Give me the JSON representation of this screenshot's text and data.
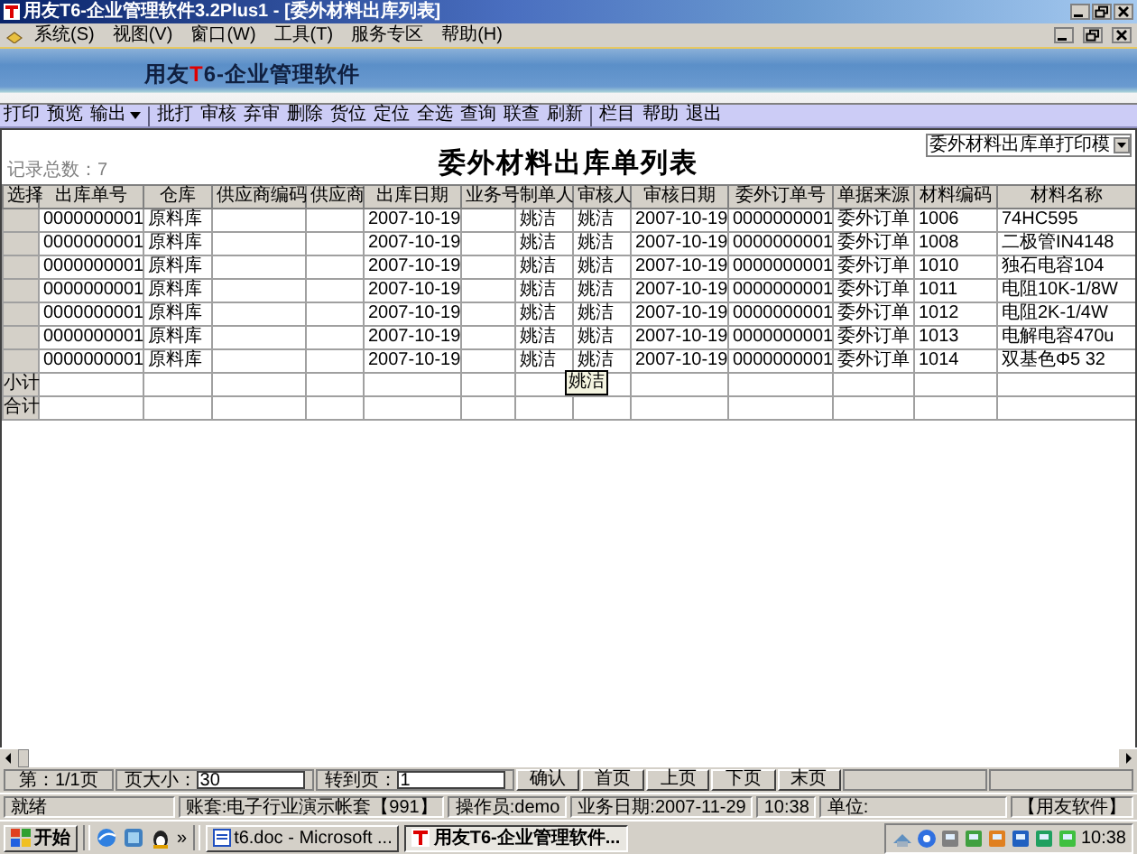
{
  "window": {
    "title": "用友T6-企业管理软件3.2Plus1 - [委外材料出库列表]"
  },
  "menu": [
    "系统(S)",
    "视图(V)",
    "窗口(W)",
    "工具(T)",
    "服务专区",
    "帮助(H)"
  ],
  "banner": {
    "prefix": "用友",
    "accent": "T",
    "suffix": "6-企业管理软件"
  },
  "toolbar": [
    [
      {
        "label": "打印",
        "kind": "button"
      },
      {
        "label": "预览",
        "kind": "button"
      },
      {
        "label": "输出",
        "kind": "dropdown"
      }
    ],
    [
      {
        "label": "批打",
        "kind": "button"
      },
      {
        "label": "审核",
        "kind": "button"
      },
      {
        "label": "弃审",
        "kind": "button"
      },
      {
        "label": "删除",
        "kind": "button"
      },
      {
        "label": "货位",
        "kind": "button"
      },
      {
        "label": "定位",
        "kind": "button"
      },
      {
        "label": "全选",
        "kind": "button"
      },
      {
        "label": "查询",
        "kind": "button"
      },
      {
        "label": "联查",
        "kind": "button"
      },
      {
        "label": "刷新",
        "kind": "button"
      }
    ],
    [
      {
        "label": "栏目",
        "kind": "button"
      },
      {
        "label": "帮助",
        "kind": "button"
      },
      {
        "label": "退出",
        "kind": "button"
      }
    ]
  ],
  "report": {
    "title": "委外材料出库单列表",
    "record_count": "记录总数：7",
    "template": "委外材料出库单打印模"
  },
  "table": {
    "columns": [
      "选择",
      "出库单号",
      "仓库",
      "供应商编码",
      "供应商",
      "出库日期",
      "业务号",
      "制单人",
      "审核人",
      "审核日期",
      "委外订单号",
      "单据来源",
      "材料编码",
      "材料名称"
    ],
    "rows": [
      {
        "cells": [
          "",
          "0000000001",
          "原料库",
          "",
          "",
          "2007-10-19",
          "",
          "姚洁",
          "姚洁",
          "2007-10-19",
          "0000000001",
          "委外订单",
          "1006",
          "74HC595"
        ]
      },
      {
        "cells": [
          "",
          "0000000001",
          "原料库",
          "",
          "",
          "2007-10-19",
          "",
          "姚洁",
          "姚洁",
          "2007-10-19",
          "0000000001",
          "委外订单",
          "1008",
          "二极管IN4148"
        ]
      },
      {
        "cells": [
          "",
          "0000000001",
          "原料库",
          "",
          "",
          "2007-10-19",
          "",
          "姚洁",
          "姚洁",
          "2007-10-19",
          "0000000001",
          "委外订单",
          "1010",
          "独石电容104"
        ]
      },
      {
        "cells": [
          "",
          "0000000001",
          "原料库",
          "",
          "",
          "2007-10-19",
          "",
          "姚洁",
          "姚洁",
          "2007-10-19",
          "0000000001",
          "委外订单",
          "1011",
          "电阻10K-1/8W"
        ]
      },
      {
        "cells": [
          "",
          "0000000001",
          "原料库",
          "",
          "",
          "2007-10-19",
          "",
          "姚洁",
          "姚洁",
          "2007-10-19",
          "0000000001",
          "委外订单",
          "1012",
          "电阻2K-1/4W"
        ]
      },
      {
        "cells": [
          "",
          "0000000001",
          "原料库",
          "",
          "",
          "2007-10-19",
          "",
          "姚洁",
          "姚洁",
          "2007-10-19",
          "0000000001",
          "委外订单",
          "1013",
          "电解电容470u"
        ]
      },
      {
        "cells": [
          "",
          "0000000001",
          "原料库",
          "",
          "",
          "2007-10-19",
          "",
          "姚洁",
          "姚洁",
          "2007-10-19",
          "0000000001",
          "委外订单",
          "1014",
          "双基色Φ5 32"
        ]
      }
    ],
    "summary_rows": [
      "小计",
      "合计"
    ]
  },
  "tooltip": "姚洁",
  "pager": {
    "page": "第：1/1页",
    "page_size_label": "页大小：",
    "page_size": "30",
    "goto_label": "转到页：",
    "goto_page": "1",
    "buttons": [
      "确认",
      "首页",
      "上页",
      "下页",
      "末页"
    ]
  },
  "status_bar": [
    "就绪",
    "账套:电子行业演示帐套【991】",
    "操作员:demo",
    "业务日期:2007-11-29",
    "10:38",
    "单位:",
    "【用友软件】"
  ],
  "taskbar": {
    "start": "开始",
    "more": "»",
    "tasks": [
      {
        "label": "t6.doc - Microsoft ...",
        "selected": false
      },
      {
        "label": "用友T6-企业管理软件...",
        "selected": true
      }
    ],
    "clock": "10:38"
  }
}
